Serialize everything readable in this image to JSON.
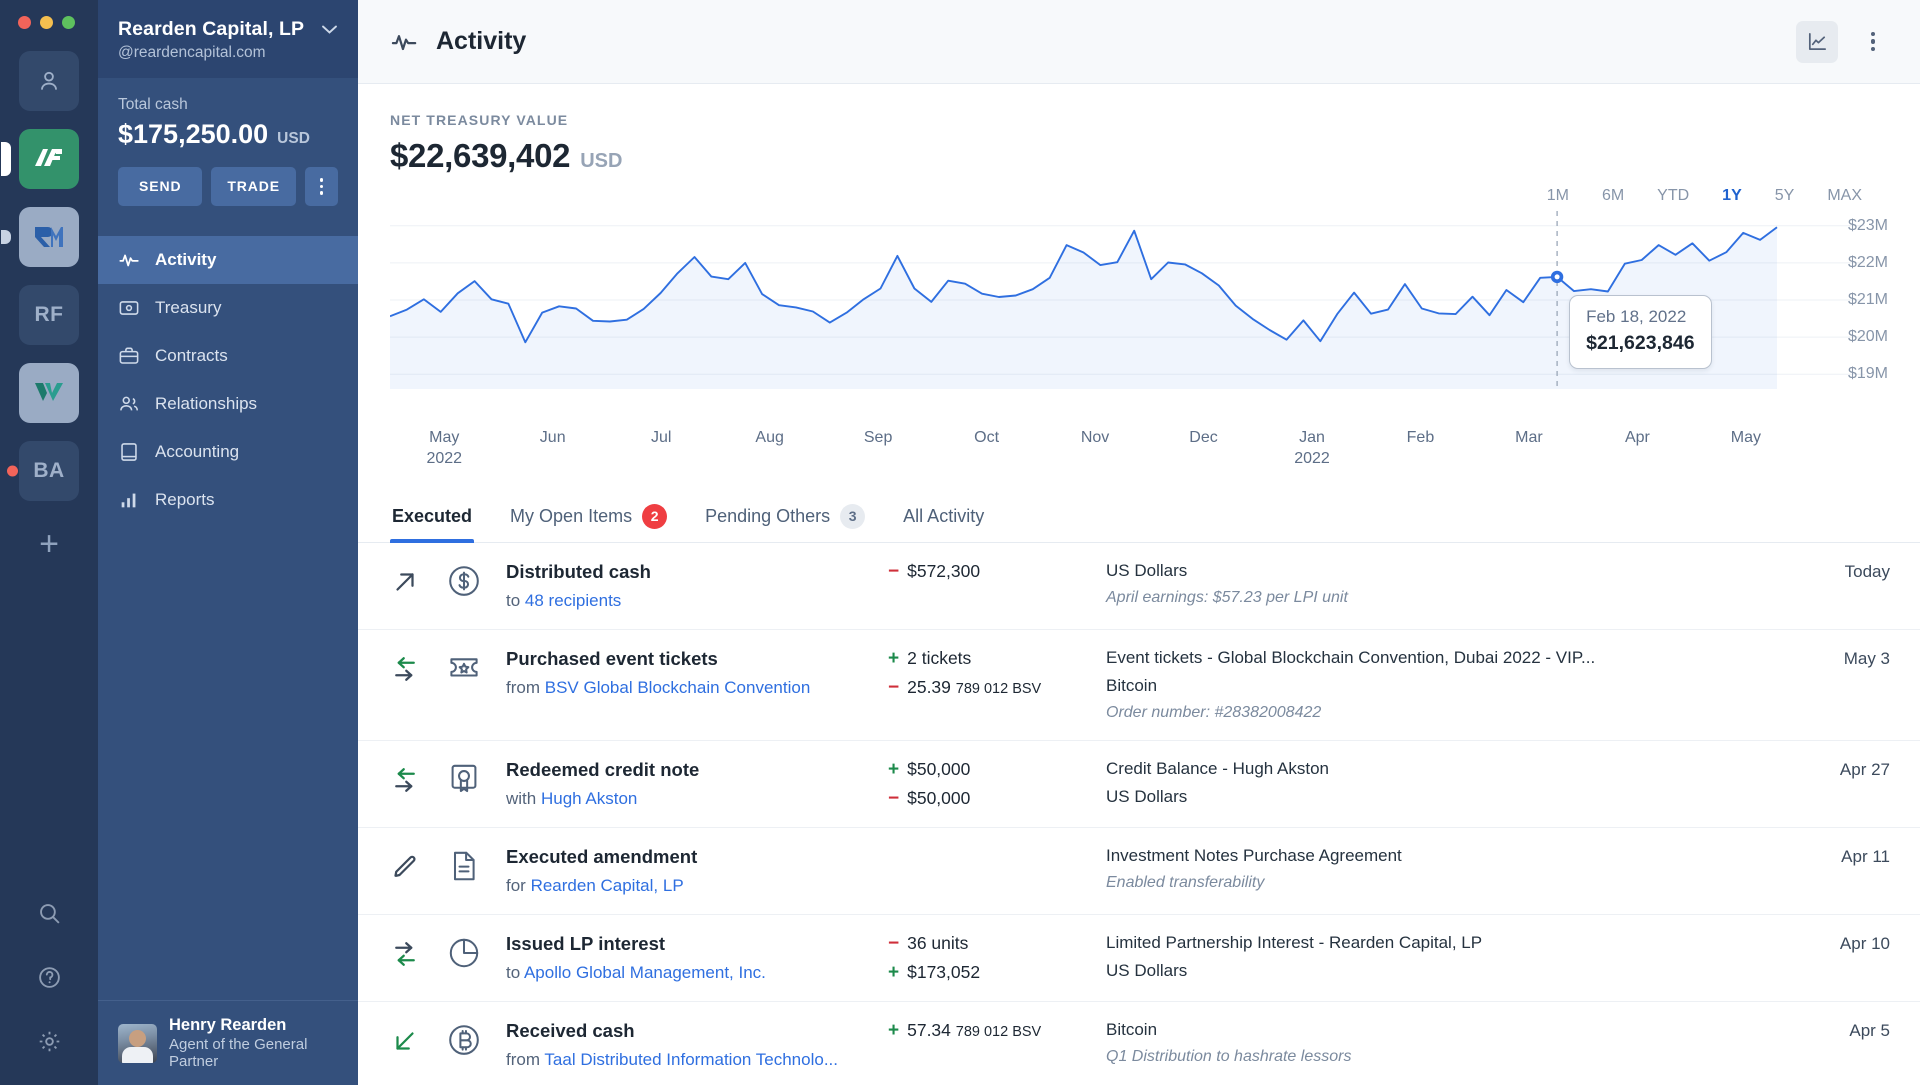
{
  "rail": {
    "workspaces": [
      {
        "name": "user-profile",
        "label": "",
        "kind": "avatar"
      },
      {
        "name": "rearden-capital",
        "label": "RC",
        "kind": "logo-green",
        "active": true
      },
      {
        "name": "rm-workspace",
        "label": "RM",
        "kind": "logo-blue"
      },
      {
        "name": "rf-workspace",
        "label": "RF",
        "kind": "text"
      },
      {
        "name": "w-workspace",
        "label": "W",
        "kind": "logo-teal"
      },
      {
        "name": "ba-workspace",
        "label": "BA",
        "kind": "text",
        "notification": true
      }
    ],
    "add_label": "+",
    "bottom_icons": [
      "search-icon",
      "help-icon",
      "settings-icon"
    ]
  },
  "sidebar": {
    "org_name": "Rearden Capital, LP",
    "handle": "@reardencapital.com",
    "cash_label": "Total cash",
    "cash_value": "$175,250.00",
    "cash_currency": "USD",
    "send_label": "SEND",
    "trade_label": "TRADE",
    "nav": [
      {
        "label": "Activity",
        "icon": "activity-icon",
        "active": true
      },
      {
        "label": "Treasury",
        "icon": "treasury-icon",
        "active": false
      },
      {
        "label": "Contracts",
        "icon": "contracts-icon",
        "active": false
      },
      {
        "label": "Relationships",
        "icon": "relationships-icon",
        "active": false
      },
      {
        "label": "Accounting",
        "icon": "accounting-icon",
        "active": false
      },
      {
        "label": "Reports",
        "icon": "reports-icon",
        "active": false
      }
    ],
    "profile_name": "Henry Rearden",
    "profile_role": "Agent of the General Partner"
  },
  "header": {
    "title": "Activity",
    "icon": "activity-icon"
  },
  "treasury": {
    "label": "NET TREASURY VALUE",
    "value": "$22,639,402",
    "currency": "USD"
  },
  "chart_data": {
    "type": "line",
    "title": "NET TREASURY VALUE",
    "xlabel": "",
    "ylabel": "",
    "ylim": [
      18600000,
      23400000
    ],
    "ytick_labels": [
      "$23M",
      "$22M",
      "$21M",
      "$20M",
      "$19M"
    ],
    "ytick_values": [
      23000000,
      22000000,
      21000000,
      20000000,
      19000000
    ],
    "grid": true,
    "legend": null,
    "ranges": [
      {
        "label": "1M",
        "selected": false
      },
      {
        "label": "6M",
        "selected": false
      },
      {
        "label": "YTD",
        "selected": false
      },
      {
        "label": "1Y",
        "selected": true
      },
      {
        "label": "5Y",
        "selected": false
      },
      {
        "label": "MAX",
        "selected": false
      }
    ],
    "xtick_labels": [
      {
        "month": "May",
        "year": "2022"
      },
      {
        "month": "Jun",
        "year": ""
      },
      {
        "month": "Jul",
        "year": ""
      },
      {
        "month": "Aug",
        "year": ""
      },
      {
        "month": "Sep",
        "year": ""
      },
      {
        "month": "Oct",
        "year": ""
      },
      {
        "month": "Nov",
        "year": ""
      },
      {
        "month": "Dec",
        "year": ""
      },
      {
        "month": "Jan",
        "year": "2022"
      },
      {
        "month": "Feb",
        "year": ""
      },
      {
        "month": "Mar",
        "year": ""
      },
      {
        "month": "Apr",
        "year": ""
      },
      {
        "month": "May",
        "year": ""
      }
    ],
    "tooltip": {
      "date": "Feb 18, 2022",
      "value": "$21,623,846"
    },
    "series_color": "#2f6fe0",
    "values": [
      20560000,
      20740000,
      21020000,
      20680000,
      21180000,
      21510000,
      21020000,
      20900000,
      19860000,
      20660000,
      20830000,
      20770000,
      20440000,
      20420000,
      20470000,
      20760000,
      21190000,
      21720000,
      22160000,
      21630000,
      21560000,
      22000000,
      21160000,
      20860000,
      20800000,
      20690000,
      20390000,
      20660000,
      21020000,
      21310000,
      22190000,
      21310000,
      20950000,
      21520000,
      21440000,
      21170000,
      21080000,
      21120000,
      21290000,
      21600000,
      22480000,
      22280000,
      21940000,
      22020000,
      22870000,
      21560000,
      22010000,
      21960000,
      21720000,
      21390000,
      20850000,
      20490000,
      20190000,
      19930000,
      20450000,
      19890000,
      20620000,
      21200000,
      20630000,
      20740000,
      21430000,
      20770000,
      20640000,
      20620000,
      21090000,
      20590000,
      21270000,
      20940000,
      21600000,
      21623846,
      21240000,
      21290000,
      21230000,
      21980000,
      22080000,
      22480000,
      22220000,
      22530000,
      22060000,
      22290000,
      22810000,
      22620000,
      22960000
    ],
    "highlight_index": 69
  },
  "tabs": [
    {
      "label": "Executed",
      "badge": null,
      "badge_kind": null,
      "active": true
    },
    {
      "label": "My Open Items",
      "badge": "2",
      "badge_kind": "red",
      "active": false
    },
    {
      "label": "Pending Others",
      "badge": "3",
      "badge_kind": "grey",
      "active": false
    },
    {
      "label": "All Activity",
      "badge": null,
      "badge_kind": null,
      "active": false
    }
  ],
  "activity_rows": [
    {
      "direction_icon": "arrow-up-right-icon",
      "type_icon": "dollar-circle-icon",
      "title": "Distributed cash",
      "sub_prefix": "to",
      "sub_link": "48 recipients",
      "amounts": [
        {
          "sign": "−",
          "sign_kind": "neg",
          "value": "$572,300",
          "frac": ""
        }
      ],
      "assets": [
        "US Dollars"
      ],
      "note": "April earnings: $57.23 per LPI unit",
      "date": "Today"
    },
    {
      "direction_icon": "arrows-left-right-icon",
      "type_icon": "ticket-icon",
      "title": "Purchased event tickets",
      "sub_prefix": "from",
      "sub_link": "BSV Global Blockchain Convention",
      "amounts": [
        {
          "sign": "+",
          "sign_kind": "pos",
          "value": "2 tickets",
          "frac": ""
        },
        {
          "sign": "−",
          "sign_kind": "neg",
          "value": "25.39",
          "frac": "789 012 BSV"
        }
      ],
      "assets": [
        "Event tickets - Global Blockchain Convention, Dubai 2022 - VIP...",
        "Bitcoin"
      ],
      "note": "Order number: #28382008422",
      "date": "May 3"
    },
    {
      "direction_icon": "arrows-left-right-icon",
      "type_icon": "certificate-icon",
      "title": "Redeemed credit note",
      "sub_prefix": "with",
      "sub_link": "Hugh Akston",
      "amounts": [
        {
          "sign": "+",
          "sign_kind": "pos",
          "value": "$50,000",
          "frac": ""
        },
        {
          "sign": "−",
          "sign_kind": "neg",
          "value": "$50,000",
          "frac": ""
        }
      ],
      "assets": [
        "Credit Balance - Hugh Akston",
        "US Dollars"
      ],
      "note": "",
      "date": "Apr 27"
    },
    {
      "direction_icon": "pencil-icon",
      "type_icon": "document-icon",
      "title": "Executed amendment",
      "sub_prefix": "for",
      "sub_link": "Rearden Capital, LP",
      "amounts": [],
      "assets": [
        "Investment Notes Purchase Agreement"
      ],
      "note": "Enabled transferability",
      "date": "Apr 11"
    },
    {
      "direction_icon": "arrows-right-left-icon",
      "type_icon": "pie-chart-icon",
      "title": "Issued LP interest",
      "sub_prefix": "to",
      "sub_link": "Apollo Global Management, Inc.",
      "amounts": [
        {
          "sign": "−",
          "sign_kind": "neg",
          "value": "36 units",
          "frac": ""
        },
        {
          "sign": "+",
          "sign_kind": "pos",
          "value": "$173,052",
          "frac": ""
        }
      ],
      "assets": [
        "Limited Partnership Interest - Rearden Capital, LP",
        "US Dollars"
      ],
      "note": "",
      "date": "Apr 10"
    },
    {
      "direction_icon": "arrow-down-left-icon",
      "type_icon": "bitcoin-icon",
      "title": "Received cash",
      "sub_prefix": "from",
      "sub_link": "Taal Distributed Information Technolo...",
      "amounts": [
        {
          "sign": "+",
          "sign_kind": "pos",
          "value": "57.34",
          "frac": "789 012 BSV"
        }
      ],
      "assets": [
        "Bitcoin"
      ],
      "note": "Q1 Distribution to hashrate lessors",
      "date": "Apr 5"
    }
  ],
  "colors": {
    "accent_blue": "#2f6fe0",
    "sidebar_navy": "#34507c",
    "rail_navy": "#253858",
    "positive_green": "#1c8a4b",
    "negative_red": "#cf2f3a",
    "badge_red": "#ef3e42"
  }
}
